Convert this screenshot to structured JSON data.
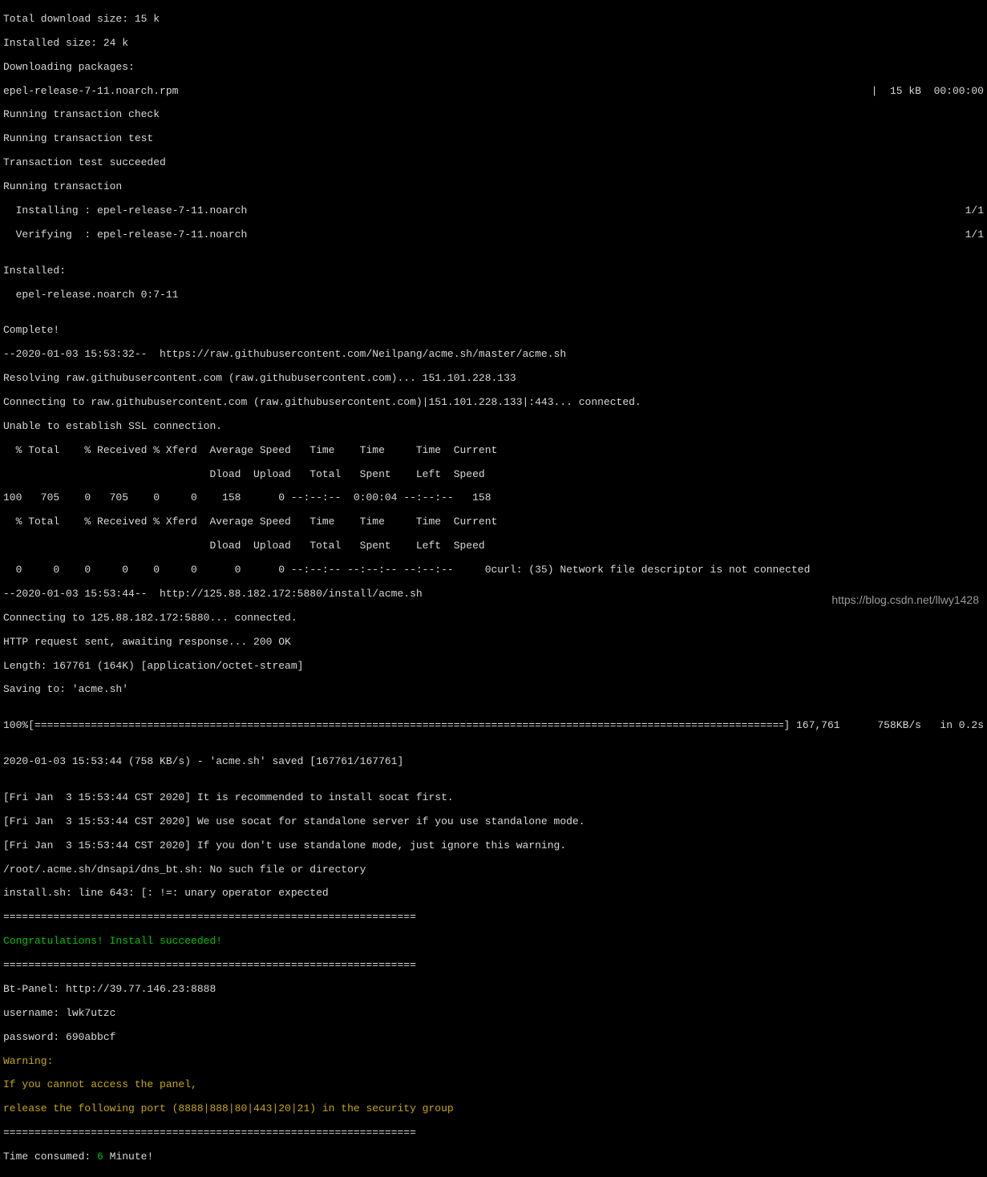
{
  "lines": {
    "l1": "Total download size: 15 k",
    "l2": "Installed size: 24 k",
    "l3": "Downloading packages:",
    "l4_left": "epel-release-7-11.noarch.rpm",
    "l4_right": "|  15 kB  00:00:00",
    "l5": "Running transaction check",
    "l6": "Running transaction test",
    "l7": "Transaction test succeeded",
    "l8": "Running transaction",
    "l9_left": "  Installing : epel-release-7-11.noarch",
    "l9_right": "1/1",
    "l10_left": "  Verifying  : epel-release-7-11.noarch",
    "l10_right": "1/1",
    "l11": "",
    "l12": "Installed:",
    "l13": "  epel-release.noarch 0:7-11",
    "l14": "",
    "l15": "Complete!",
    "l16": "--2020-01-03 15:53:32--  https://raw.githubusercontent.com/Neilpang/acme.sh/master/acme.sh",
    "l17": "Resolving raw.githubusercontent.com (raw.githubusercontent.com)... 151.101.228.133",
    "l18": "Connecting to raw.githubusercontent.com (raw.githubusercontent.com)|151.101.228.133|:443... connected.",
    "l19": "Unable to establish SSL connection.",
    "l20": "  % Total    % Received % Xferd  Average Speed   Time    Time     Time  Current",
    "l21": "                                 Dload  Upload   Total   Spent    Left  Speed",
    "l22": "100   705    0   705    0     0    158      0 --:--:--  0:00:04 --:--:--   158",
    "l23": "  % Total    % Received % Xferd  Average Speed   Time    Time     Time  Current",
    "l24": "                                 Dload  Upload   Total   Spent    Left  Speed",
    "l25": "  0     0    0     0    0     0      0      0 --:--:-- --:--:-- --:--:--     0curl: (35) Network file descriptor is not connected",
    "l26": "--2020-01-03 15:53:44--  http://125.88.182.172:5880/install/acme.sh",
    "l27": "Connecting to 125.88.182.172:5880... connected.",
    "l28": "HTTP request sent, awaiting response... 200 OK",
    "l29": "Length: 167761 (164K) [application/octet-stream]",
    "l30": "Saving to: 'acme.sh'",
    "l31": "",
    "progress_left": "100%[",
    "progress_bar": "==================================================================================================================================================>",
    "progress_right": "] 167,761      758KB/s   in 0.2s",
    "l33": "",
    "l34": "2020-01-03 15:53:44 (758 KB/s) - 'acme.sh' saved [167761/167761]",
    "l35": "",
    "l36": "[Fri Jan  3 15:53:44 CST 2020] It is recommended to install socat first.",
    "l37": "[Fri Jan  3 15:53:44 CST 2020] We use socat for standalone server if you use standalone mode.",
    "l38": "[Fri Jan  3 15:53:44 CST 2020] If you don't use standalone mode, just ignore this warning.",
    "l39": "/root/.acme.sh/dnsapi/dns_bt.sh: No such file or directory",
    "l40": "install.sh: line 643: [: !=: unary operator expected",
    "sep1": "==================================================================",
    "congrats": "Congratulations! Install succeeded!",
    "sep2": "==================================================================",
    "panel": "Bt-Panel: http://39.77.146.23:8888",
    "username": "username: lwk7utzc",
    "password": "password: 690abbcf",
    "warning": "Warning:",
    "warn1": "If you cannot access the panel,",
    "warn2": "release the following port (8888|888|80|443|20|21) in the security group",
    "sep3": "==================================================================",
    "time_pre": "Time consumed: ",
    "time_num": "6",
    "time_post": " Minute!"
  },
  "watermark": "https://blog.csdn.net/llwy1428"
}
